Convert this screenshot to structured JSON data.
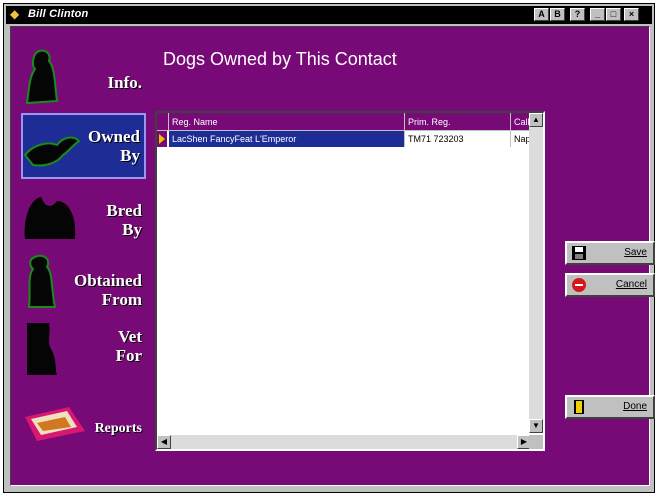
{
  "window": {
    "title": "Bill Clinton"
  },
  "titlebar_buttons": [
    "A",
    "B",
    "?",
    "_",
    "□",
    "×"
  ],
  "page": {
    "heading": "Dogs Owned by This Contact"
  },
  "nav": [
    {
      "key": "info",
      "label": "Info."
    },
    {
      "key": "owned-by",
      "label": "Owned\nBy"
    },
    {
      "key": "bred-by",
      "label": "Bred\nBy"
    },
    {
      "key": "obtained-from",
      "label": "Obtained\nFrom"
    },
    {
      "key": "vet-for",
      "label": "Vet\nFor"
    },
    {
      "key": "reports",
      "label": "Reports"
    }
  ],
  "grid": {
    "columns": [
      "Reg. Name",
      "Prim. Reg.",
      "Call N"
    ],
    "rows": [
      [
        "LacShen FancyFeat L'Emperor",
        "TM71 723203",
        "Napol"
      ]
    ]
  },
  "buttons": {
    "save": "Save",
    "cancel": "Cancel",
    "done": "Done"
  }
}
